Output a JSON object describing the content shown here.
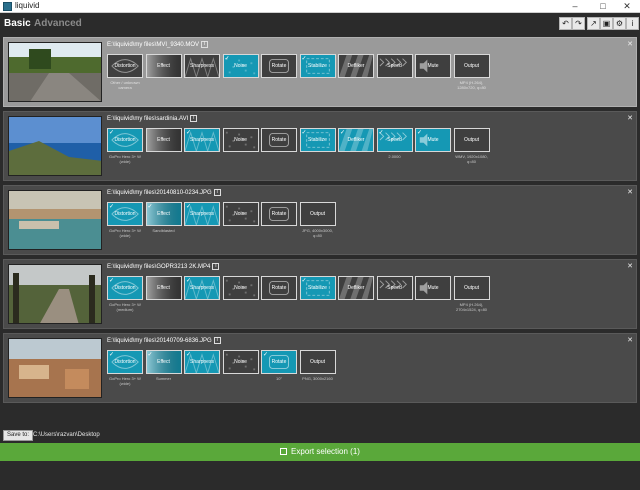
{
  "window": {
    "title": "liquivid"
  },
  "tabs": [
    {
      "label": "Basic"
    },
    {
      "label": "Advanced"
    }
  ],
  "toolbar_icons": [
    "undo-icon",
    "redo-icon",
    "export-settings-icon",
    "camera-icon",
    "settings-icon",
    "info-icon"
  ],
  "rows": [
    {
      "path": "E:\\liquivid\\my files\\MVI_9340.MOV",
      "selected": true,
      "filters": [
        {
          "label": "Distortion",
          "state": "off",
          "checked": false,
          "sub": "Other / unknown camera"
        },
        {
          "label": "Effect",
          "state": "off",
          "checked": false,
          "sub": ""
        },
        {
          "label": "Sharpness",
          "state": "off",
          "checked": false,
          "sub": ""
        },
        {
          "label": "Noise",
          "state": "active",
          "checked": true,
          "sub": ""
        },
        {
          "label": "Rotate",
          "state": "off",
          "checked": false,
          "sub": ""
        },
        {
          "label": "Stabilize",
          "state": "active",
          "checked": true,
          "sub": ""
        },
        {
          "label": "Defliker",
          "state": "off",
          "checked": false,
          "sub": ""
        },
        {
          "label": "Speed",
          "state": "off",
          "checked": false,
          "sub": ""
        },
        {
          "label": "Mute",
          "state": "off",
          "checked": false,
          "sub": ""
        },
        {
          "label": "Output",
          "state": "off",
          "checked": false,
          "sub": "MP4 (H.264), 1280x720, q=80"
        }
      ]
    },
    {
      "path": "E:\\liquivid\\my files\\sardinia.AVI",
      "selected": false,
      "filters": [
        {
          "label": "Distortion",
          "state": "active",
          "checked": true,
          "sub": "GoPro Hero 3+ W (wide)"
        },
        {
          "label": "Effect",
          "state": "off",
          "checked": false,
          "sub": ""
        },
        {
          "label": "Sharpness",
          "state": "active",
          "checked": true,
          "sub": ""
        },
        {
          "label": "Noise",
          "state": "off",
          "checked": false,
          "sub": ""
        },
        {
          "label": "Rotate",
          "state": "off",
          "checked": false,
          "sub": ""
        },
        {
          "label": "Stabilize",
          "state": "active",
          "checked": true,
          "sub": ""
        },
        {
          "label": "Defliker",
          "state": "active",
          "checked": true,
          "sub": ""
        },
        {
          "label": "Speed",
          "state": "active",
          "checked": true,
          "sub": "2.0000"
        },
        {
          "label": "Mute",
          "state": "active",
          "checked": true,
          "sub": ""
        },
        {
          "label": "Output",
          "state": "off",
          "checked": false,
          "sub": "WMV, 1920x1080, q=80"
        }
      ]
    },
    {
      "path": "E:\\liquivid\\my files\\20140810-0234.JPG",
      "selected": false,
      "filters": [
        {
          "label": "Distortion",
          "state": "active",
          "checked": true,
          "sub": "GoPro Hero 3+ W (wide)"
        },
        {
          "label": "Effect",
          "state": "active",
          "checked": true,
          "sub": "Sandblasted"
        },
        {
          "label": "Sharpness",
          "state": "active",
          "checked": true,
          "sub": ""
        },
        {
          "label": "Noise",
          "state": "off",
          "checked": false,
          "sub": ""
        },
        {
          "label": "Rotate",
          "state": "off",
          "checked": false,
          "sub": ""
        },
        {
          "label": "Output",
          "state": "off",
          "checked": false,
          "sub": "JPG, 4000x3000, q=80"
        }
      ]
    },
    {
      "path": "E:\\liquivid\\my files\\GOPR3213 2K.MP4",
      "selected": false,
      "filters": [
        {
          "label": "Distortion",
          "state": "active",
          "checked": true,
          "sub": "GoPro Hero 3+ W (medium)"
        },
        {
          "label": "Effect",
          "state": "off",
          "checked": false,
          "sub": ""
        },
        {
          "label": "Sharpness",
          "state": "active",
          "checked": true,
          "sub": ""
        },
        {
          "label": "Noise",
          "state": "off",
          "checked": false,
          "sub": ""
        },
        {
          "label": "Rotate",
          "state": "off",
          "checked": false,
          "sub": ""
        },
        {
          "label": "Stabilize",
          "state": "active",
          "checked": true,
          "sub": ""
        },
        {
          "label": "Defliker",
          "state": "off",
          "checked": false,
          "sub": ""
        },
        {
          "label": "Speed",
          "state": "off",
          "checked": false,
          "sub": ""
        },
        {
          "label": "Mute",
          "state": "off",
          "checked": false,
          "sub": ""
        },
        {
          "label": "Output",
          "state": "off",
          "checked": false,
          "sub": "MP4 (H.264), 2704x1524, q=80"
        }
      ]
    },
    {
      "path": "E:\\liquivid\\my files\\20140709-6836.JPG",
      "selected": false,
      "filters": [
        {
          "label": "Distortion",
          "state": "active",
          "checked": true,
          "sub": "GoPro Hero 3+ W (wide)"
        },
        {
          "label": "Effect",
          "state": "active",
          "checked": true,
          "sub": "Summer"
        },
        {
          "label": "Sharpness",
          "state": "active",
          "checked": true,
          "sub": ""
        },
        {
          "label": "Noise",
          "state": "off",
          "checked": false,
          "sub": ""
        },
        {
          "label": "Rotate",
          "state": "active",
          "checked": true,
          "sub": "10°"
        },
        {
          "label": "Output",
          "state": "off",
          "checked": false,
          "sub": "PNG, 3000x2160"
        }
      ]
    }
  ],
  "save": {
    "button_label": "Save to:",
    "path": "C:\\Users\\razvan\\Desktop"
  },
  "export": {
    "label": "Export selection (1)"
  },
  "colors": {
    "accent": "#1598b4",
    "export_green": "#5aa83a",
    "selected_row": "#9a9a9a"
  }
}
